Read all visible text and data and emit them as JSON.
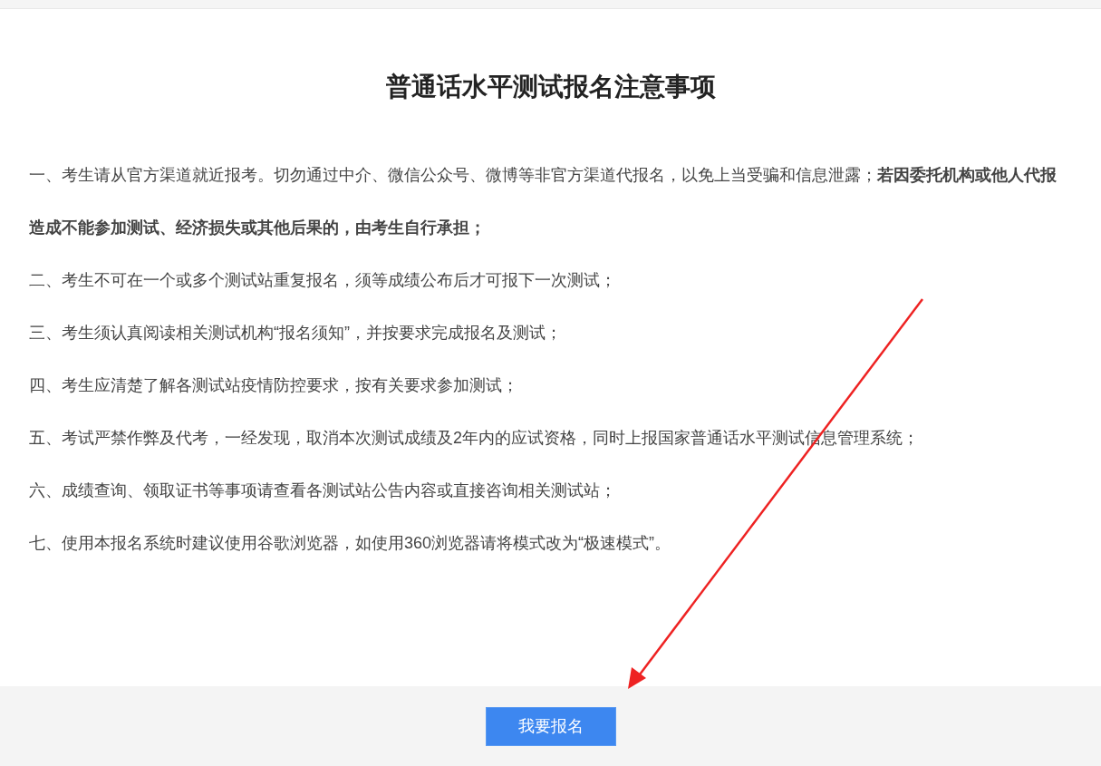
{
  "title": "普通话水平测试报名注意事项",
  "items": [
    "一、考生请从官方渠道就近报考。切勿通过中介、微信公众号、微博等非官方渠道代报名，以免上当受骗和信息泄露；**若因委托机构或他人代报造成不能参加测试、经济损失或其他后果的，由考生自行承担；**",
    "二、考生不可在一个或多个测试站重复报名，须等成绩公布后才可报下一次测试；",
    "三、考生须认真阅读相关测试机构“报名须知”，并按要求完成报名及测试；",
    "四、考生应清楚了解各测试站疫情防控要求，按有关要求参加测试；",
    "五、考试严禁作弊及代考，一经发现，取消本次测试成绩及2年内的应试资格，同时上报国家普通话水平测试信息管理系统；",
    "六、成绩查询、领取证书等事项请查看各测试站公告内容或直接咨询相关测试站；",
    "七、使用本报名系统时建议使用谷歌浏览器，如使用360浏览器请将模式改为“极速模式”。"
  ],
  "button": "我要报名"
}
